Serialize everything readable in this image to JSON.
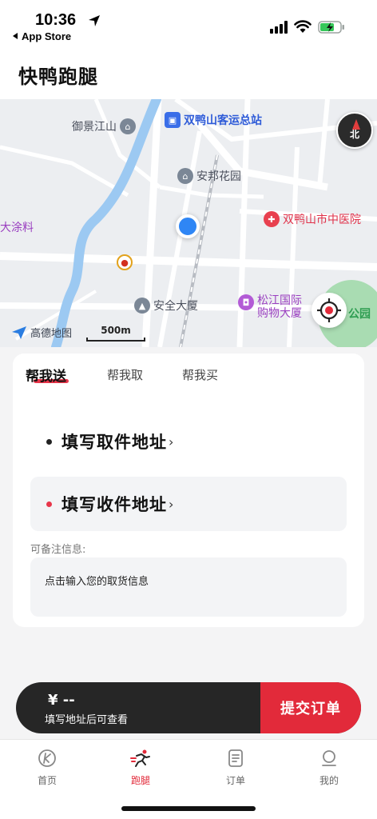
{
  "status_bar": {
    "time": "10:36",
    "back_app": "App Store"
  },
  "header": {
    "title": "快鸭跑腿"
  },
  "map": {
    "pois": {
      "yujing": "御景江山",
      "bus_station": "双鸭山客运总站",
      "anbang": "安邦花园",
      "hospital": "双鸭山市中医院",
      "tuliao": "大涂料",
      "anquan": "安全大厦",
      "songjiang_1": "松江国际",
      "songjiang_2": "购物大厦",
      "park": "公园"
    },
    "compass_label": "北",
    "provider": "高德地图",
    "scale": "500m"
  },
  "order": {
    "tabs": [
      "帮我送",
      "帮我取",
      "帮我买"
    ],
    "active_tab": "帮我送",
    "pickup_label": "填写取件地址",
    "delivery_label": "填写收件地址",
    "note_label": "可备注信息:",
    "note_placeholder": "点击输入您的取货信息",
    "accent_color": "#e8354a"
  },
  "submit": {
    "price": "¥ --",
    "hint": "填写地址后可查看",
    "button": "提交订单"
  },
  "bottom_nav": {
    "items": [
      {
        "label": "首页",
        "icon": "home-k-icon"
      },
      {
        "label": "跑腿",
        "icon": "runner-icon"
      },
      {
        "label": "订单",
        "icon": "order-list-icon"
      },
      {
        "label": "我的",
        "icon": "profile-icon"
      }
    ],
    "active": "跑腿"
  }
}
